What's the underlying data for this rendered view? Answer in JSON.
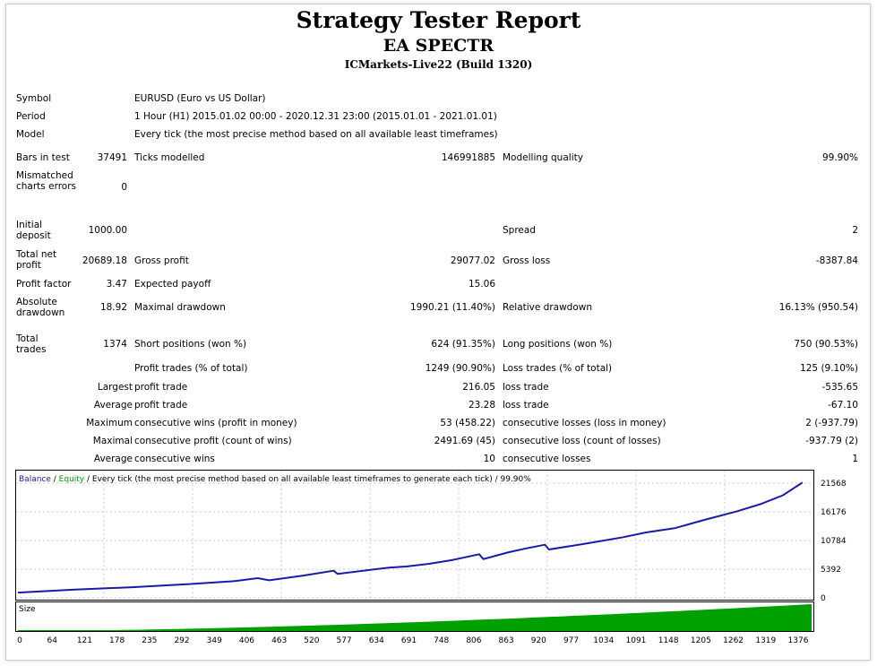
{
  "report": {
    "title": "Strategy Tester Report",
    "ea_name": "EA SPECTR",
    "server": "ICMarkets-Live22 (Build 1320)"
  },
  "settings": {
    "symbol_label": "Symbol",
    "symbol_value": "EURUSD (Euro vs US Dollar)",
    "period_label": "Period",
    "period_value": "1 Hour (H1) 2015.01.02 00:00 - 2020.12.31 23:00 (2015.01.01 - 2021.01.01)",
    "model_label": "Model",
    "model_value": "Every tick (the most precise method based on all available least timeframes)"
  },
  "stats": {
    "bars_label": "Bars in test",
    "bars_value": "37491",
    "ticks_label": "Ticks modelled",
    "ticks_value": "146991885",
    "quality_label": "Modelling quality",
    "quality_value": "99.90%",
    "mismatch_label": "Mismatched charts errors",
    "mismatch_value": "0",
    "deposit_label": "Initial deposit",
    "deposit_value": "1000.00",
    "spread_label": "Spread",
    "spread_value": "2",
    "netprofit_label": "Total net profit",
    "netprofit_value": "20689.18",
    "grossprofit_label": "Gross profit",
    "grossprofit_value": "29077.02",
    "grossloss_label": "Gross loss",
    "grossloss_value": "-8387.84",
    "pf_label": "Profit factor",
    "pf_value": "3.47",
    "ep_label": "Expected payoff",
    "ep_value": "15.06",
    "absdd_label": "Absolute drawdown",
    "absdd_value": "18.92",
    "maxdd_label": "Maximal drawdown",
    "maxdd_value": "1990.21 (11.40%)",
    "reldd_label": "Relative drawdown",
    "reldd_value": "16.13% (950.54)",
    "trades_label": "Total trades",
    "trades_value": "1374",
    "short_label": "Short positions (won %)",
    "short_value": "624 (91.35%)",
    "long_label": "Long positions (won %)",
    "long_value": "750 (90.53%)",
    "pt_label": "Profit trades (% of total)",
    "pt_value": "1249 (90.90%)",
    "lt_label": "Loss trades (% of total)",
    "lt_value": "125 (9.10%)",
    "largest_label": "Largest",
    "largest_profit_label": "profit trade",
    "largest_profit_value": "216.05",
    "largest_loss_label": "loss trade",
    "largest_loss_value": "-535.65",
    "average_label": "Average",
    "average_profit_label": "profit trade",
    "average_profit_value": "23.28",
    "average_loss_label": "loss trade",
    "average_loss_value": "-67.10",
    "maximum_label": "Maximum",
    "max_wins_label": "consecutive wins (profit in money)",
    "max_wins_value": "53 (458.22)",
    "max_losses_label": "consecutive losses (loss in money)",
    "max_losses_value": "2 (-937.79)",
    "maximal_label": "Maximal",
    "maximal_profit_label": "consecutive profit (count of wins)",
    "maximal_profit_value": "2491.69 (45)",
    "maximal_loss_label": "consecutive loss (count of losses)",
    "maximal_loss_value": "-937.79 (2)",
    "avg_consec_label": "Average",
    "avg_wins_label": "consecutive wins",
    "avg_wins_value": "10",
    "avg_losses_label": "consecutive losses",
    "avg_losses_value": "1"
  },
  "chart_data": {
    "type": "line",
    "legend": {
      "balance": "Balance",
      "sep1": " / ",
      "equity": "Equity",
      "rest": " / Every tick (the most precise method based on all available least timeframes to generate each tick) / 99.90%"
    },
    "series": [
      {
        "name": "Balance",
        "color": "#1b1ba8",
        "x": [
          0,
          100,
          200,
          300,
          380,
          420,
          440,
          500,
          553,
          560,
          620,
          650,
          680,
          720,
          760,
          808,
          815,
          860,
          890,
          923,
          930,
          1000,
          1060,
          1100,
          1150,
          1200,
          1260,
          1300,
          1340,
          1374
        ],
        "y": [
          1000,
          1550,
          2000,
          2600,
          3150,
          3700,
          3300,
          4200,
          5100,
          4500,
          5300,
          5700,
          5900,
          6400,
          7100,
          8200,
          7300,
          8600,
          9300,
          10000,
          9100,
          10300,
          11400,
          12300,
          13100,
          14600,
          16300,
          17600,
          19300,
          21689
        ]
      }
    ],
    "y_ticks": [
      "21568",
      "16176",
      "10784",
      "5392",
      "0"
    ],
    "y_tick_values": [
      21568,
      16176,
      10784,
      5392,
      0
    ],
    "ylim": [
      0,
      21568
    ],
    "xlim": [
      0,
      1390
    ],
    "x_ticks": [
      "0",
      "64",
      "121",
      "178",
      "235",
      "292",
      "349",
      "406",
      "463",
      "520",
      "577",
      "634",
      "691",
      "748",
      "806",
      "863",
      "920",
      "977",
      "1034",
      "1091",
      "1148",
      "1205",
      "1262",
      "1319",
      "1376"
    ],
    "size_panel": {
      "label": "Size",
      "color": "#00a000",
      "shape": "increasing lot size from ~0 to max"
    }
  }
}
